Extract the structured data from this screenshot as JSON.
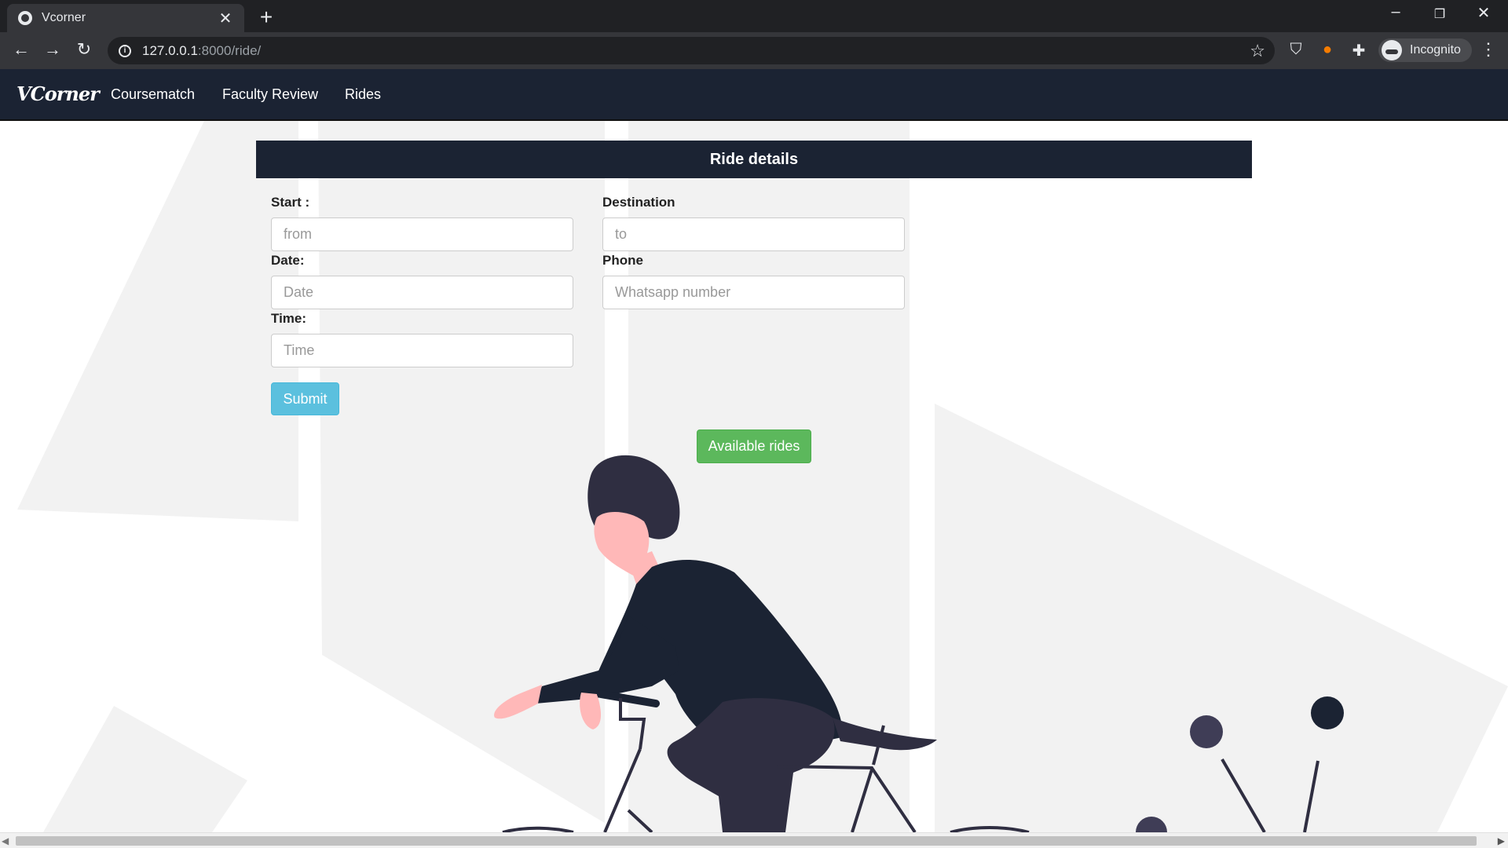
{
  "browser": {
    "tab_title": "Vcorner",
    "tab_close": "✕",
    "new_tab": "+",
    "url_host": "127.0.0.1",
    "url_path": ":8000/ride/",
    "profile_label": "Incognito",
    "window_controls": {
      "minimize": "–",
      "restore": "❐",
      "close": "✕"
    },
    "nav": {
      "back": "←",
      "forward": "→",
      "reload": "↻"
    },
    "icons": [
      "info-icon",
      "star-icon",
      "shield-extension-icon",
      "fox-extension-icon",
      "puzzle-extensions-icon",
      "incognito-icon",
      "kebab-menu-icon"
    ]
  },
  "site": {
    "brand": "VCorner",
    "nav_links": [
      "Coursematch",
      "Faculty Review",
      "Rides"
    ]
  },
  "form": {
    "header": "Ride details",
    "start_label": "Start :",
    "start_placeholder": "from",
    "destination_label": "Destination",
    "destination_placeholder": "to",
    "date_label": "Date:",
    "date_placeholder": "Date",
    "phone_label": "Phone",
    "phone_placeholder": "Whatsapp number",
    "time_label": "Time:",
    "time_placeholder": "Time",
    "submit_label": "Submit",
    "available_rides_label": "Available rides"
  },
  "colors": {
    "navbar": "#1b2333",
    "submit": "#5bc0de",
    "available_rides": "#5cb85c",
    "illustration_dark": "#2f2e41",
    "illustration_skin": "#ffb8b8"
  }
}
